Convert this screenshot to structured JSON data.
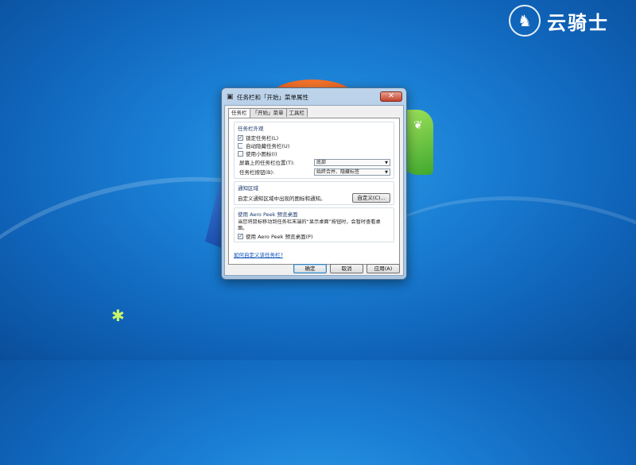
{
  "logo": {
    "text": "云骑士"
  },
  "window": {
    "title": "任务栏和「开始」菜单属性",
    "close": "✕"
  },
  "tabs": [
    {
      "label": "任务栏",
      "active": true
    },
    {
      "label": "「开始」菜单",
      "active": false
    },
    {
      "label": "工具栏",
      "active": false
    }
  ],
  "appearance": {
    "title": "任务栏外观",
    "lock": {
      "label": "锁定任务栏(L)",
      "checked": true
    },
    "autohide": {
      "label": "自动隐藏任务栏(U)",
      "checked": false
    },
    "smallicons": {
      "label": "使用小图标(I)",
      "checked": false
    },
    "location": {
      "label": "屏幕上的任务栏位置(T):",
      "value": "底部"
    },
    "buttons": {
      "label": "任务栏按钮(B):",
      "value": "始终合并、隐藏标签"
    }
  },
  "notification": {
    "title": "通知区域",
    "desc": "自定义通知区域中出现的图标和通知。",
    "button": "自定义(C)..."
  },
  "aero": {
    "title": "使用 Aero Peek 预览桌面",
    "desc": "当您将鼠标移动到任务栏末端的“显示桌面”按钮时，会暂时查看桌面。",
    "checkbox": {
      "label": "使用 Aero Peek 预览桌面(P)",
      "checked": true
    }
  },
  "help_link": "如何自定义该任务栏?",
  "footer": {
    "ok": "确定",
    "cancel": "取消",
    "apply": "应用(A)"
  },
  "colors": {
    "desktop": "#1a7fd4",
    "accent": "#0a4fb8"
  }
}
